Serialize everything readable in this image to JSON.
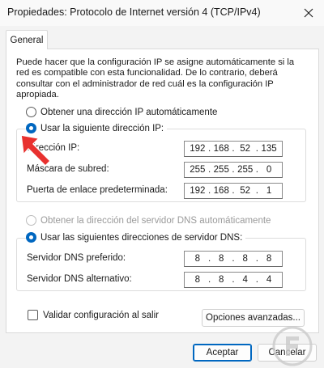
{
  "window": {
    "title": "Propiedades: Protocolo de Internet versión 4 (TCP/IPv4)",
    "close_icon": "close-icon"
  },
  "tabs": [
    {
      "label": "General",
      "active": true
    }
  ],
  "description": "Puede hacer que la configuración IP se asigne automáticamente si la red es compatible con esta funcionalidad. De lo contrario, deberá consultar con el administrador de red cuál es la configuración IP apropiada.",
  "ip_section": {
    "auto_label": "Obtener una dirección IP automáticamente",
    "auto_selected": false,
    "manual_label": "Usar la siguiente dirección IP:",
    "manual_selected": true,
    "fields": [
      {
        "label": "Dirección IP:",
        "octets": [
          "192",
          "168",
          "52",
          "135"
        ]
      },
      {
        "label": "Máscara de subred:",
        "octets": [
          "255",
          "255",
          "255",
          "0"
        ]
      },
      {
        "label": "Puerta de enlace predeterminada:",
        "octets": [
          "192",
          "168",
          "52",
          "1"
        ]
      }
    ]
  },
  "dns_section": {
    "auto_label": "Obtener la dirección del servidor DNS automáticamente",
    "auto_enabled": false,
    "manual_label": "Usar las siguientes direcciones de servidor DNS:",
    "manual_selected": true,
    "fields": [
      {
        "label": "Servidor DNS preferido:",
        "octets": [
          "8",
          "8",
          "8",
          "8"
        ]
      },
      {
        "label": "Servidor DNS alternativo:",
        "octets": [
          "8",
          "8",
          "4",
          "4"
        ]
      }
    ]
  },
  "validate_checkbox": {
    "label": "Validar configuración al salir",
    "checked": false
  },
  "buttons": {
    "advanced": "Opciones avanzadas...",
    "ok": "Aceptar",
    "cancel": "Cancelar"
  },
  "colors": {
    "accent": "#0067c0",
    "arrow": "#e8312f"
  }
}
